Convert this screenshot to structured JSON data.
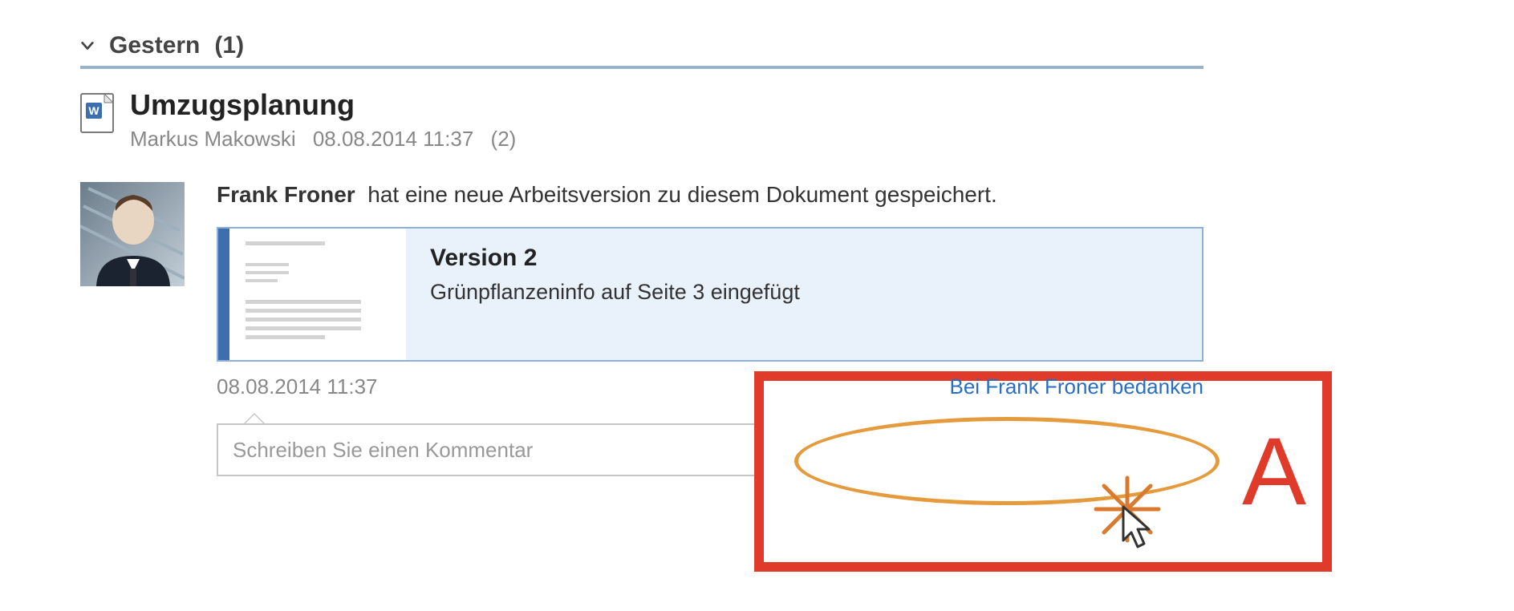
{
  "group": {
    "label": "Gestern",
    "count": "(1)"
  },
  "entry": {
    "title": "Umzugsplanung",
    "author": "Markus Makowski",
    "timestamp": "08.08.2014 11:37",
    "count": "(2)"
  },
  "activity": {
    "actor": "Frank Froner",
    "action_text": "hat eine neue Arbeitsversion zu diesem Dokument gespeichert.",
    "version": {
      "label": "Version 2",
      "description": "Grünpflanzeninfo auf Seite 3 eingefügt"
    },
    "timestamp": "08.08.2014 11:37",
    "thank_link": "Bei Frank Froner bedanken"
  },
  "comment": {
    "placeholder": "Schreiben Sie einen Kommentar"
  },
  "annotation": {
    "label": "A"
  }
}
